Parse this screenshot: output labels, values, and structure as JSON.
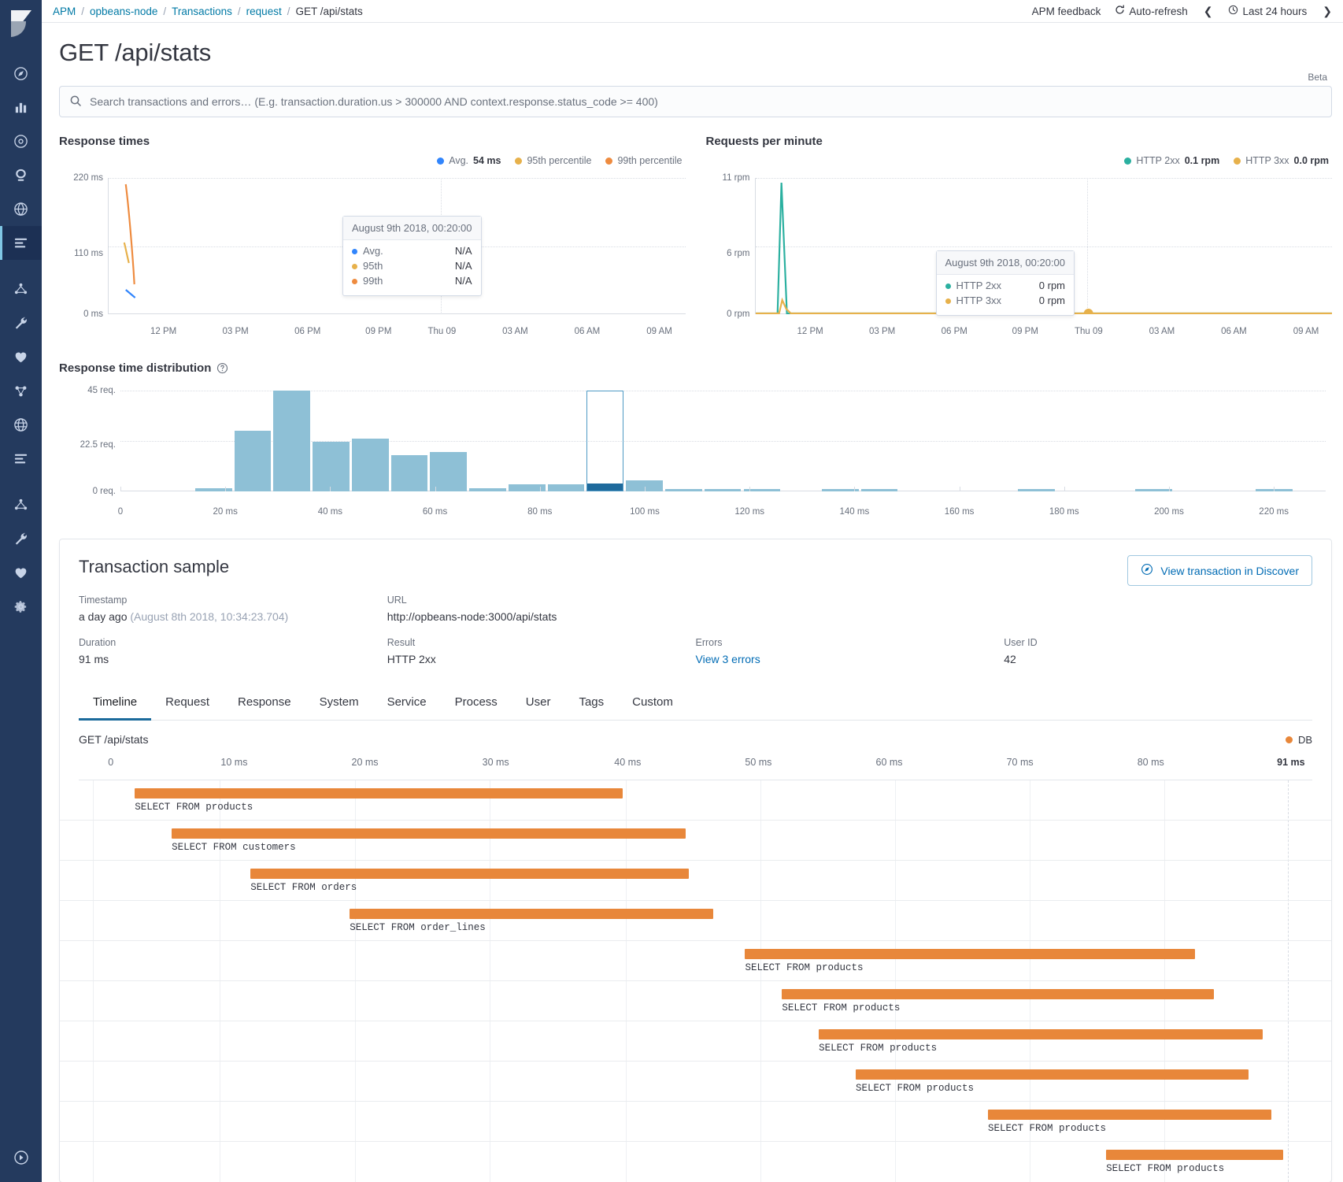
{
  "topbar": {
    "breadcrumbs": [
      {
        "label": "APM",
        "link": true
      },
      {
        "label": "opbeans-node",
        "link": true
      },
      {
        "label": "Transactions",
        "link": true
      },
      {
        "label": "request",
        "link": true
      },
      {
        "label": "GET /api/stats",
        "link": false
      }
    ],
    "separator": "/",
    "feedback_label": "APM feedback",
    "autorefresh_label": "Auto-refresh",
    "timerange_label": "Last 24 hours",
    "prev_icon": "chevron-left-icon",
    "next_icon": "chevron-right-icon",
    "refresh_icon": "refresh-icon",
    "clock_icon": "clock-icon"
  },
  "page": {
    "title": "GET /api/stats",
    "beta_label": "Beta"
  },
  "search": {
    "placeholder": "Search transactions and errors… (E.g. transaction.duration.us > 300000 AND context.response.status_code >= 400)",
    "value": "",
    "icon": "search-icon"
  },
  "colors": {
    "avg": "#3185FC",
    "p95": "#E7B14B",
    "p99": "#EE8B3F",
    "http2xx": "#2BB0A0",
    "http3xx": "#E7B14B",
    "bar": "#8EC0D6",
    "bar_selected": "#1E6A9C",
    "span_db": "#E8873A",
    "link": "#006BB4"
  },
  "chart_data": [
    {
      "type": "line",
      "title": "Response times",
      "xlabel": "",
      "ylabel": "",
      "ylim": [
        0,
        220
      ],
      "yticks": [
        "0 ms",
        "110 ms",
        "220 ms"
      ],
      "ytick_values": [
        0,
        110,
        220
      ],
      "xticks": [
        "12 PM",
        "03 PM",
        "06 PM",
        "09 PM",
        "Thu 09",
        "03 AM",
        "06 AM",
        "09 AM"
      ],
      "grid": true,
      "legend_position": "top-right",
      "legend": [
        {
          "name": "Avg.",
          "value": "54 ms",
          "color": "#3185FC"
        },
        {
          "name": "95th percentile",
          "value": "",
          "color": "#E7B14B"
        },
        {
          "name": "99th percentile",
          "value": "",
          "color": "#EE8B3F"
        }
      ],
      "series": [
        {
          "name": "Avg.",
          "color": "#3185FC",
          "values": [
            52,
            38,
            0,
            0,
            0,
            0,
            0,
            0,
            0
          ]
        },
        {
          "name": "95th percentile",
          "color": "#E7B14B",
          "values": [
            108,
            92,
            0,
            0,
            0,
            0,
            0,
            0,
            0
          ]
        },
        {
          "name": "99th percentile",
          "color": "#EE8B3F",
          "values": [
            214,
            120,
            60,
            0,
            0,
            0,
            0,
            0,
            0
          ]
        }
      ],
      "tooltip": {
        "title": "August 9th 2018, 00:20:00",
        "rows": [
          {
            "name": "Avg.",
            "value": "N/A",
            "color": "#3185FC"
          },
          {
            "name": "95th",
            "value": "N/A",
            "color": "#E7B14B"
          },
          {
            "name": "99th",
            "value": "N/A",
            "color": "#EE8B3F"
          }
        ]
      }
    },
    {
      "type": "line",
      "title": "Requests per minute",
      "xlabel": "",
      "ylabel": "",
      "ylim": [
        0,
        11
      ],
      "yticks": [
        "0 rpm",
        "6 rpm",
        "11 rpm"
      ],
      "ytick_values": [
        0,
        6,
        11
      ],
      "xticks": [
        "12 PM",
        "03 PM",
        "06 PM",
        "09 PM",
        "Thu 09",
        "03 AM",
        "06 AM",
        "09 AM"
      ],
      "grid": true,
      "legend_position": "top-right",
      "legend": [
        {
          "name": "HTTP 2xx",
          "value": "0.1 rpm",
          "color": "#2BB0A0"
        },
        {
          "name": "HTTP 3xx",
          "value": "0.0 rpm",
          "color": "#E7B14B"
        }
      ],
      "series": [
        {
          "name": "HTTP 2xx",
          "color": "#2BB0A0",
          "values": [
            0,
            10.6,
            0,
            0,
            0,
            0,
            0,
            0,
            0
          ]
        },
        {
          "name": "HTTP 3xx",
          "color": "#E7B14B",
          "values": [
            0,
            1.0,
            0,
            0,
            0,
            0,
            0,
            0,
            0
          ]
        }
      ],
      "marker": {
        "x_label": "Thu 09",
        "color": "#E7B14B"
      },
      "tooltip": {
        "title": "August 9th 2018, 00:20:00",
        "rows": [
          {
            "name": "HTTP 2xx",
            "value": "0 rpm",
            "color": "#2BB0A0"
          },
          {
            "name": "HTTP 3xx",
            "value": "0 rpm",
            "color": "#E7B14B"
          }
        ]
      }
    },
    {
      "type": "bar",
      "title": "Response time distribution",
      "help_icon": "question-circle-icon",
      "xlabel": "",
      "ylabel": "",
      "ylim": [
        0,
        45
      ],
      "yticks": [
        "0 req.",
        "22.5 req.",
        "45 req."
      ],
      "ytick_values": [
        0,
        22.5,
        45
      ],
      "xticks": [
        "0",
        "20 ms",
        "40 ms",
        "60 ms",
        "80 ms",
        "100 ms",
        "120 ms",
        "140 ms",
        "160 ms",
        "180 ms",
        "200 ms",
        "220 ms"
      ],
      "xlim": [
        0,
        230
      ],
      "bin_width": 7.5,
      "selected_bin_index": 12,
      "bins": [
        {
          "x": 0,
          "count": 0
        },
        {
          "x": 7.5,
          "count": 0
        },
        {
          "x": 15,
          "count": 1.5
        },
        {
          "x": 22.5,
          "count": 27
        },
        {
          "x": 30,
          "count": 45
        },
        {
          "x": 37.5,
          "count": 22
        },
        {
          "x": 45,
          "count": 23.5
        },
        {
          "x": 52.5,
          "count": 16
        },
        {
          "x": 60,
          "count": 17.5
        },
        {
          "x": 67.5,
          "count": 1.5
        },
        {
          "x": 75,
          "count": 3
        },
        {
          "x": 82.5,
          "count": 3
        },
        {
          "x": 90,
          "count": 3.5
        },
        {
          "x": 97.5,
          "count": 5
        },
        {
          "x": 105,
          "count": 1
        },
        {
          "x": 112.5,
          "count": 1
        },
        {
          "x": 120,
          "count": 1
        },
        {
          "x": 127.5,
          "count": 0
        },
        {
          "x": 135,
          "count": 1
        },
        {
          "x": 142.5,
          "count": 1
        },
        {
          "x": 150,
          "count": 0
        },
        {
          "x": 157.5,
          "count": 0
        },
        {
          "x": 165,
          "count": 0
        },
        {
          "x": 172.5,
          "count": 1
        },
        {
          "x": 180,
          "count": 0
        },
        {
          "x": 187.5,
          "count": 0
        },
        {
          "x": 195,
          "count": 1
        },
        {
          "x": 202.5,
          "count": 0
        },
        {
          "x": 210,
          "count": 0
        },
        {
          "x": 217.5,
          "count": 1
        }
      ]
    }
  ],
  "sample": {
    "title": "Transaction sample",
    "discover_button": "View transaction in Discover",
    "discover_icon": "discover-icon",
    "fields": [
      {
        "label": "Timestamp",
        "value": "a day ago",
        "suffix": "(August 8th 2018, 10:34:23.704)",
        "link": false
      },
      {
        "label": "URL",
        "value": "http://opbeans-node:3000/api/stats",
        "suffix": "",
        "link": false
      },
      {
        "label": "Duration",
        "value": "91 ms",
        "suffix": "",
        "link": false
      },
      {
        "label": "Result",
        "value": "HTTP 2xx",
        "suffix": "",
        "link": false
      },
      {
        "label": "Errors",
        "value": "View 3 errors",
        "suffix": "",
        "link": true
      },
      {
        "label": "User ID",
        "value": "42",
        "suffix": "",
        "link": false
      }
    ],
    "tabs": [
      {
        "label": "Timeline",
        "active": true
      },
      {
        "label": "Request",
        "active": false
      },
      {
        "label": "Response",
        "active": false
      },
      {
        "label": "System",
        "active": false
      },
      {
        "label": "Service",
        "active": false
      },
      {
        "label": "Process",
        "active": false
      },
      {
        "label": "User",
        "active": false
      },
      {
        "label": "Tags",
        "active": false
      },
      {
        "label": "Custom",
        "active": false
      }
    ]
  },
  "timeline": {
    "name": "GET /api/stats",
    "legend_label": "DB",
    "legend_color": "#E8873A",
    "axis_ticks": [
      "0",
      "10 ms",
      "20 ms",
      "30 ms",
      "40 ms",
      "50 ms",
      "60 ms",
      "70 ms",
      "80 ms"
    ],
    "axis_end": "91 ms",
    "total_ms": 91,
    "spans": [
      {
        "label": "SELECT FROM products",
        "start_ms": 6.5,
        "duration_ms": 39.0
      },
      {
        "label": "SELECT FROM customers",
        "start_ms": 9.2,
        "duration_ms": 41.0
      },
      {
        "label": "SELECT FROM orders",
        "start_ms": 16.0,
        "duration_ms": 35.0
      },
      {
        "label": "SELECT FROM order_lines",
        "start_ms": 23.5,
        "duration_ms": 29.0
      },
      {
        "label": "SELECT FROM products",
        "start_ms": 55.0,
        "duration_ms": 36.5
      },
      {
        "label": "SELECT FROM products",
        "start_ms": 58.0,
        "duration_ms": 35.0
      },
      {
        "label": "SELECT FROM products",
        "start_ms": 61.0,
        "duration_ms": 36.0
      },
      {
        "label": "SELECT FROM products",
        "start_ms": 64.0,
        "duration_ms": 31.5
      },
      {
        "label": "SELECT FROM products",
        "start_ms": 74.5,
        "duration_ms": 22.5
      },
      {
        "label": "SELECT FROM products",
        "start_ms": 84.0,
        "duration_ms": 14.0
      }
    ]
  },
  "leftnav": {
    "logo": "kibana-logo",
    "items": [
      {
        "icon": "discover-icon",
        "active": false
      },
      {
        "icon": "visualize-icon",
        "active": false
      },
      {
        "icon": "dashboard-icon",
        "active": false
      },
      {
        "icon": "timelion-icon",
        "active": false
      },
      {
        "icon": "canvas-icon",
        "active": false
      },
      {
        "icon": "apm-icon",
        "active": true
      },
      {
        "icon": "machine-learning-icon",
        "active": false
      },
      {
        "icon": "devtools-icon",
        "active": false
      },
      {
        "icon": "monitoring-icon",
        "active": false
      },
      {
        "icon": "graph-icon",
        "active": false
      },
      {
        "icon": "maps-icon",
        "active": false
      },
      {
        "icon": "logs-icon",
        "active": false
      },
      {
        "icon": "ml-jobs-icon",
        "active": false
      },
      {
        "icon": "wrench-icon",
        "active": false
      },
      {
        "icon": "heart-icon",
        "active": false
      },
      {
        "icon": "management-icon",
        "active": false
      }
    ],
    "collapse_icon": "collapse-icon"
  }
}
